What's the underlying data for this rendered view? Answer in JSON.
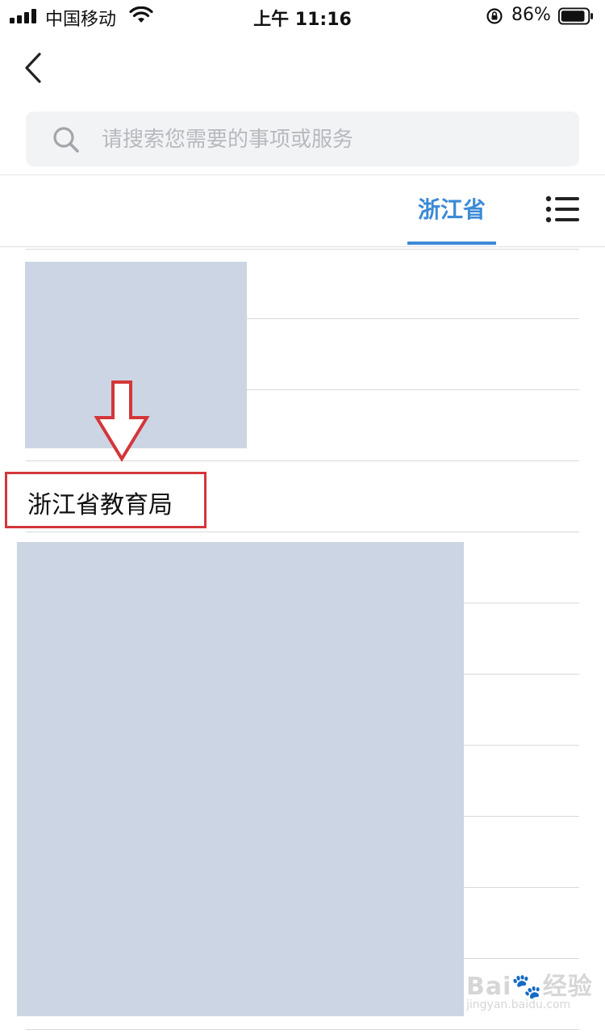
{
  "status_bar": {
    "carrier": "中国移动",
    "time": "上午 11:16",
    "battery_percent": "86%"
  },
  "search": {
    "placeholder": "请搜索您需要的事项或服务"
  },
  "tabs": {
    "active_label": "浙江省"
  },
  "list": {
    "highlighted_item": "浙江省教育局"
  },
  "watermark": {
    "main": "Bai🐾经验",
    "sub": "jingyan.baidu.com"
  },
  "colors": {
    "accent": "#3c8ad6",
    "highlight_border": "#d4363a",
    "redaction": "#ccd5e3"
  }
}
